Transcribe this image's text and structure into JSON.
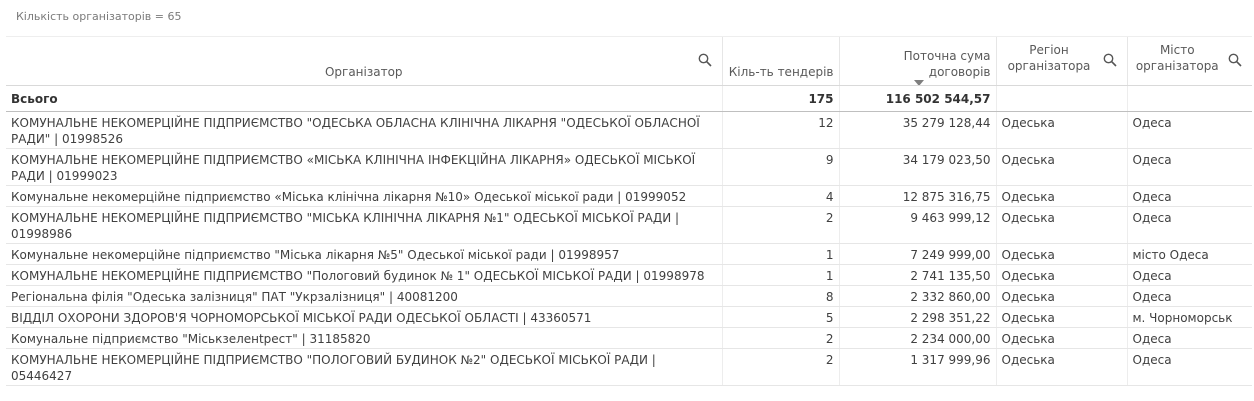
{
  "header": {
    "count_note": "Кількість організаторів = 65"
  },
  "columns": {
    "organizer": "Організатор",
    "tenders": "Кіль-ть тендерів",
    "sum": "Поточна сума договорів",
    "region": "Регіон організатора",
    "city": "Місто організатора"
  },
  "total": {
    "label": "Всього",
    "tenders": "175",
    "sum": "116 502 544,57"
  },
  "rows": [
    {
      "org": "КОМУНАЛЬНЕ НЕКОМЕРЦІЙНЕ ПІДПРИЄМСТВО \"ОДЕСЬКА ОБЛАСНА КЛІНІЧНА ЛІКАРНЯ \"ОДЕСЬКОЇ ОБЛАСНОЇ РАДИ\" | 01998526",
      "tenders": "12",
      "sum": "35 279 128,44",
      "region": "Одеська",
      "city": "Одеса"
    },
    {
      "org": "КОМУНАЛЬНЕ НЕКОМЕРЦІЙНЕ ПІДПРИЄМСТВО «МІСЬКА КЛІНІЧНА ІНФЕКЦІЙНА ЛІКАРНЯ» ОДЕСЬКОЇ МІСЬКОЇ РАДИ | 01999023",
      "tenders": "9",
      "sum": "34 179 023,50",
      "region": "Одеська",
      "city": "Одеса"
    },
    {
      "org": "Комунальне некомерційне підприємство «Міська клінічна лікарня №10» Одеської міської ради | 01999052",
      "tenders": "4",
      "sum": "12 875 316,75",
      "region": "Одеська",
      "city": "Одеса"
    },
    {
      "org": "КОМУНАЛЬНЕ НЕКОМЕРЦІЙНЕ ПІДПРИЄМСТВО \"МІСЬКА КЛІНІЧНА ЛІКАРНЯ №1\" ОДЕСЬКОЇ МІСЬКОЇ РАДИ | 01998986",
      "tenders": "2",
      "sum": "9 463 999,12",
      "region": "Одеська",
      "city": "Одеса"
    },
    {
      "org": "Комунальне некомерційне підприємство \"Міська лікарня №5\" Одеської міської ради | 01998957",
      "tenders": "1",
      "sum": "7 249 999,00",
      "region": "Одеська",
      "city": "місто Одеса"
    },
    {
      "org": "КОМУНАЛЬНЕ НЕКОМЕРЦІЙНЕ ПІДПРИЄМСТВО \"Пологовий будинок № 1\" ОДЕСЬКОЇ МІСЬКОЇ РАДИ | 01998978",
      "tenders": "1",
      "sum": "2 741 135,50",
      "region": "Одеська",
      "city": "Одеса"
    },
    {
      "org": "Регіональна філія \"Одеська залізниця\" ПАТ \"Укрзалізниця\" | 40081200",
      "tenders": "8",
      "sum": "2 332 860,00",
      "region": "Одеська",
      "city": "Одеса"
    },
    {
      "org": "ВІДДІЛ ОХОРОНИ ЗДОРОВ'Я ЧОРНОМОРСЬКОЇ МІСЬКОЇ РАДИ ОДЕСЬКОЇ ОБЛАСТІ | 43360571",
      "tenders": "5",
      "sum": "2 298 351,22",
      "region": "Одеська",
      "city": "м. Чорноморськ"
    },
    {
      "org": "Комунальне підприємство \"Міськзеленtрест\" | 31185820",
      "tenders": "2",
      "sum": "2 234 000,00",
      "region": "Одеська",
      "city": "Одеса"
    },
    {
      "org": "КОМУНАЛЬНЕ НЕКОМЕРЦІЙНЕ ПІДПРИЄМСТВО \"ПОЛОГОВИЙ БУДИНОК №2\" ОДЕСЬКОЇ МІСЬКОЇ РАДИ | 05446427",
      "tenders": "2",
      "sum": "1 317 999,96",
      "region": "Одеська",
      "city": "Одеса"
    }
  ]
}
